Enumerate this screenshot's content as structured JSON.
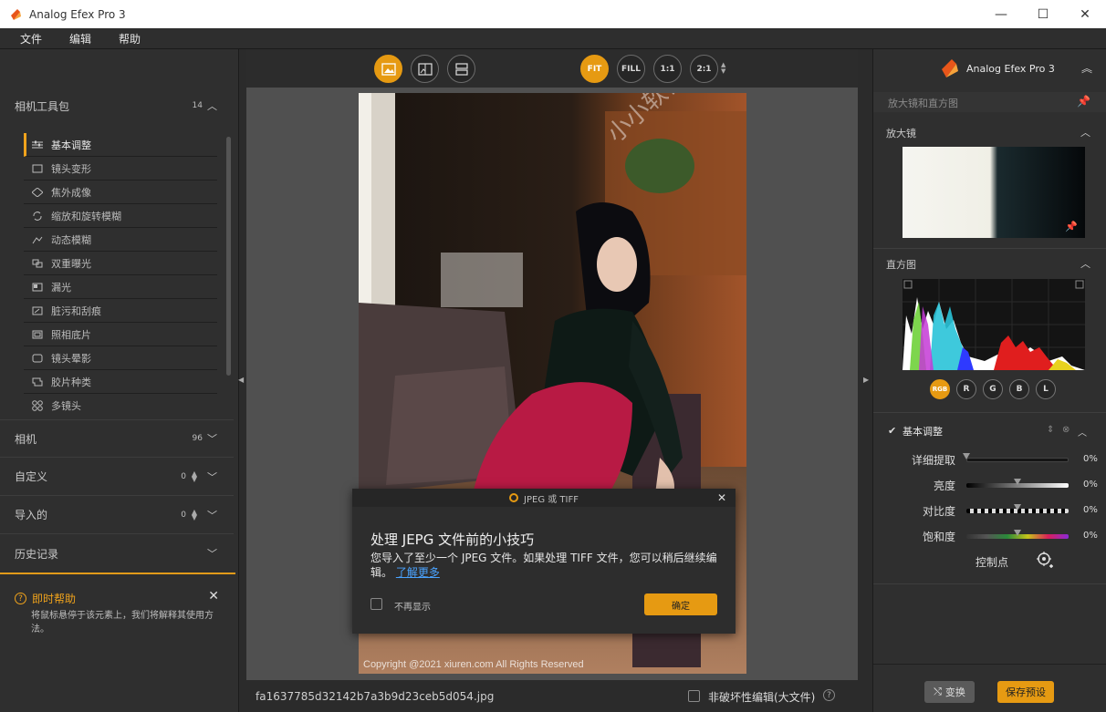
{
  "window": {
    "title": "Analog Efex Pro 3",
    "minimize": "—",
    "maximize": "☐",
    "close": "✕"
  },
  "menu": [
    "文件",
    "编辑",
    "帮助"
  ],
  "left_panel": {
    "toolkit": {
      "label": "相机工具包",
      "count": "14"
    },
    "tools": [
      {
        "label": "基本调整",
        "icon": "sliders-icon"
      },
      {
        "label": "镜头变形",
        "icon": "lens-distortion-icon"
      },
      {
        "label": "焦外成像",
        "icon": "bokeh-icon"
      },
      {
        "label": "缩放和旋转模糊",
        "icon": "rotate-blur-icon"
      },
      {
        "label": "动态模糊",
        "icon": "motion-blur-icon"
      },
      {
        "label": "双重曝光",
        "icon": "double-exposure-icon"
      },
      {
        "label": "漏光",
        "icon": "light-leak-icon"
      },
      {
        "label": "脏污和刮痕",
        "icon": "dirt-scratches-icon"
      },
      {
        "label": "照相底片",
        "icon": "film-plate-icon"
      },
      {
        "label": "镜头晕影",
        "icon": "vignette-icon"
      },
      {
        "label": "胶片种类",
        "icon": "film-type-icon"
      },
      {
        "label": "多镜头",
        "icon": "multi-lens-icon"
      }
    ],
    "sections": [
      {
        "label": "相机",
        "count": "96"
      },
      {
        "label": "自定义",
        "count": "0"
      },
      {
        "label": "导入的",
        "count": "0"
      },
      {
        "label": "历史记录",
        "count": ""
      }
    ],
    "help": {
      "title": "即时帮助",
      "text": "将鼠标悬停于该元素上，我们将解释其使用方法。",
      "close": "✕"
    }
  },
  "center": {
    "view_buttons": [
      "single-view-icon",
      "split-view-icon",
      "side-by-side-icon"
    ],
    "zoom_buttons": [
      "FIT",
      "FILL",
      "1:1",
      "2:1"
    ],
    "active_zoom": "FIT",
    "photo": {
      "watermark": "小小软件迷 www.xxrjm.com",
      "copyright": "Copyright @2021  xiuren.com  All Rights Reserved"
    },
    "filename": "fa1637785d32142b7a3b9d23ceb5d054.jpg",
    "non_destructive_label": "非破坏性编辑(大文件)",
    "help_glyph": "?"
  },
  "dialog": {
    "header": "JPEG 或 TIFF",
    "title": "处理 JEPG 文件前的小技巧",
    "body": "您导入了至少一个 JPEG 文件。如果处理 TIFF 文件，您可以稍后继续编辑。",
    "link": "了解更多",
    "checkbox_label": "不再显示",
    "ok": "确定"
  },
  "right_panel": {
    "brand": "Analog Efex Pro 3",
    "subheader": "放大镜和直方图",
    "loupe_label": "放大镜",
    "histogram_label": "直方图",
    "hist_channels": [
      "RGB",
      "R",
      "G",
      "B",
      "L"
    ],
    "active_channel": "RGB",
    "basic": {
      "label": "基本调整",
      "sliders": [
        {
          "label": "详细提取",
          "value": "0%",
          "level": 0.0
        },
        {
          "label": "亮度",
          "value": "0%",
          "level": 0.5
        },
        {
          "label": "对比度",
          "value": "0%",
          "level": 0.5
        },
        {
          "label": "饱和度",
          "value": "0%",
          "level": 0.5
        }
      ],
      "control_point": "控制点"
    },
    "swap": "变换",
    "save_preset": "保存预设"
  },
  "colors": {
    "accent": "#e69a12",
    "panel": "#2f2f2f",
    "canvas": "#505050"
  }
}
